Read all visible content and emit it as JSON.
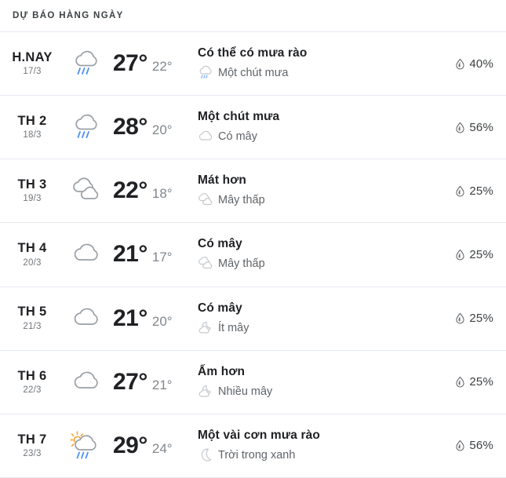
{
  "header": {
    "title": "DỰ BÁO HÀNG NGÀY"
  },
  "colors": {
    "text_primary": "#202124",
    "text_secondary": "#5f6368",
    "text_muted": "#80868b",
    "divider": "#e6eaf3",
    "rain_blue": "#4a8df6",
    "sun_orange": "#f2a33c",
    "cloud_outline": "#9aa0a6",
    "cloud_outline_light": "#c5c9ce",
    "background": "#ffffff"
  },
  "forecast": {
    "rows": [
      {
        "day": "H.NAY",
        "date": "17/3",
        "icon": "rain-cloud-icon",
        "temp_high": "27°",
        "temp_low": "22°",
        "condition": "Có thể có mưa rào",
        "sub_icon": "rain-cloud-small-icon",
        "sub_condition": "Một chút mưa",
        "precip_icon": "water-drop-icon",
        "precip": "40%"
      },
      {
        "day": "TH 2",
        "date": "18/3",
        "icon": "rain-cloud-icon",
        "temp_high": "28°",
        "temp_low": "20°",
        "condition": "Một chút mưa",
        "sub_icon": "cloud-small-icon",
        "sub_condition": "Có mây",
        "precip_icon": "water-drop-icon",
        "precip": "56%"
      },
      {
        "day": "TH 3",
        "date": "19/3",
        "icon": "double-cloud-icon",
        "temp_high": "22°",
        "temp_low": "18°",
        "condition": "Mát hơn",
        "sub_icon": "double-cloud-small-icon",
        "sub_condition": "Mây thấp",
        "precip_icon": "water-drop-icon",
        "precip": "25%"
      },
      {
        "day": "TH 4",
        "date": "20/3",
        "icon": "cloud-icon",
        "temp_high": "21°",
        "temp_low": "17°",
        "condition": "Có mây",
        "sub_icon": "double-cloud-small-icon",
        "sub_condition": "Mây thấp",
        "precip_icon": "water-drop-icon",
        "precip": "25%"
      },
      {
        "day": "TH 5",
        "date": "21/3",
        "icon": "cloud-icon",
        "temp_high": "21°",
        "temp_low": "20°",
        "condition": "Có mây",
        "sub_icon": "moon-cloud-small-icon",
        "sub_condition": "Ít mây",
        "precip_icon": "water-drop-icon",
        "precip": "25%"
      },
      {
        "day": "TH 6",
        "date": "22/3",
        "icon": "cloud-icon",
        "temp_high": "27°",
        "temp_low": "21°",
        "condition": "Ấm hơn",
        "sub_icon": "moon-cloud-small-icon",
        "sub_condition": "Nhiều mây",
        "precip_icon": "water-drop-icon",
        "precip": "25%"
      },
      {
        "day": "TH 7",
        "date": "23/3",
        "icon": "sun-rain-cloud-icon",
        "temp_high": "29°",
        "temp_low": "24°",
        "condition": "Một vài cơn mưa rào",
        "sub_icon": "moon-icon",
        "sub_condition": "Trời trong xanh",
        "precip_icon": "water-drop-icon",
        "precip": "56%"
      }
    ]
  }
}
